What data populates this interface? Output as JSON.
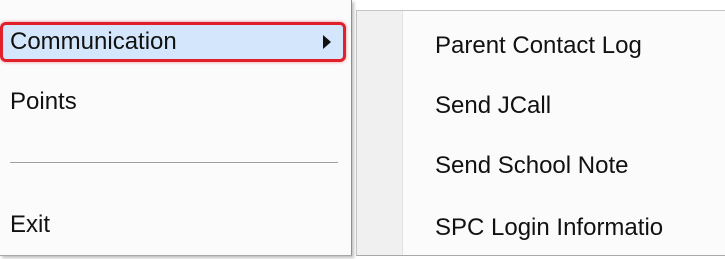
{
  "main_menu": {
    "items": [
      {
        "label": "Communication",
        "has_submenu": true,
        "highlighted": true
      },
      {
        "label": "Points"
      },
      {
        "label": "Exit"
      }
    ]
  },
  "submenu": {
    "items": [
      {
        "label": "Parent Contact Log"
      },
      {
        "label": "Send JCall"
      },
      {
        "label": "Send School Note"
      },
      {
        "label": "SPC Login Informatio"
      }
    ]
  },
  "colors": {
    "highlight_border": "#e0202a",
    "highlight_fill": "#d4e6fb",
    "menu_background": "#fbfbfb"
  },
  "icons": {
    "submenu_arrow": "chevron-right-icon"
  }
}
